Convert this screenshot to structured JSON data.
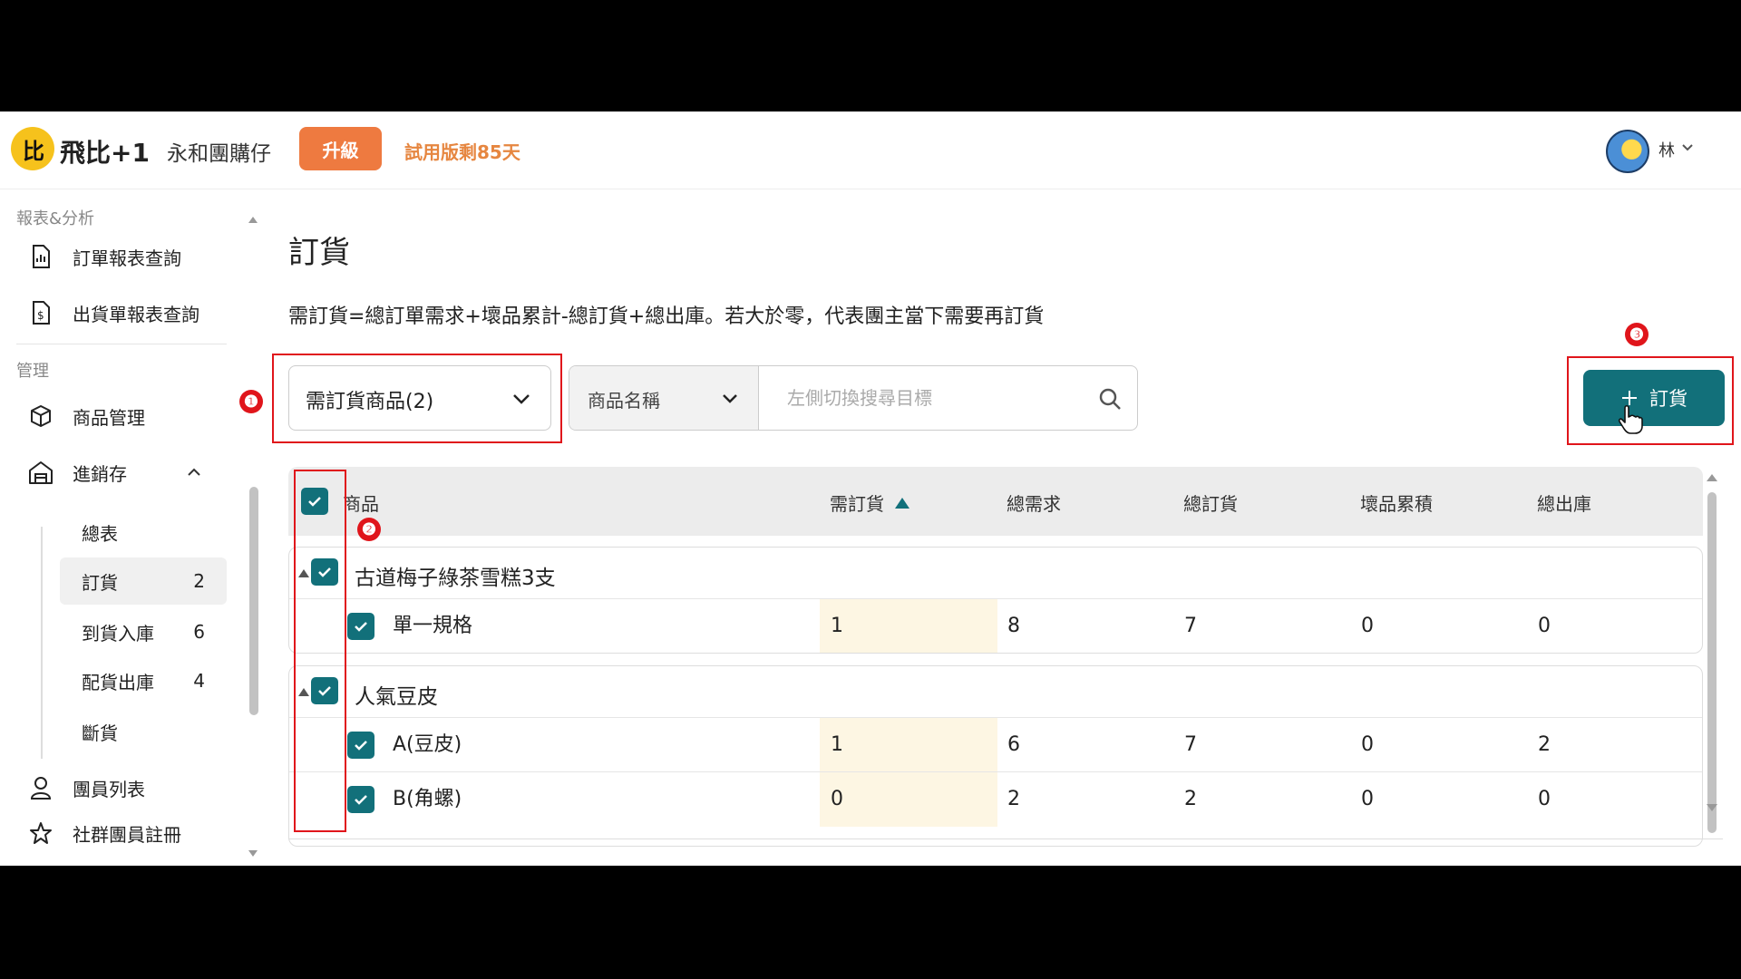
{
  "header": {
    "logo_text": "比",
    "brand": "飛比+1",
    "shop_name": "永和團購仔",
    "upgrade_label": "升級",
    "trial_text": "試用版剩85天",
    "user_name": "林"
  },
  "sidebar": {
    "section_reports": "報表&分析",
    "report_items": [
      {
        "label": "訂單報表查詢",
        "icon": "report-file-icon"
      },
      {
        "label": "出貨單報表查詢",
        "icon": "dollar-file-icon"
      }
    ],
    "section_manage": "管理",
    "manage_items": [
      {
        "label": "商品管理",
        "icon": "box-icon"
      },
      {
        "label": "進銷存",
        "icon": "warehouse-icon"
      }
    ],
    "inventory_sub": [
      {
        "label": "總表",
        "count": ""
      },
      {
        "label": "訂貨",
        "count": "2"
      },
      {
        "label": "到貨入庫",
        "count": "6"
      },
      {
        "label": "配貨出庫",
        "count": "4"
      },
      {
        "label": "斷貨",
        "count": ""
      }
    ],
    "members_label": "團員列表",
    "social_label": "社群團員註冊"
  },
  "main": {
    "title": "訂貨",
    "formula": "需訂貨=總訂單需求+壞品累計-總訂貨+總出庫。若大於零，代表團主當下需要再訂貨",
    "filter_value": "需訂貨商品(2)",
    "search_field": "商品名稱",
    "search_placeholder": "左側切換搜尋目標",
    "search_value": "",
    "order_button": "訂貨"
  },
  "table": {
    "headers": [
      "商品",
      "需訂貨",
      "總需求",
      "總訂貨",
      "壞品累積",
      "總出庫"
    ],
    "groups": [
      {
        "name": "古道梅子綠茶雪糕3支",
        "rows": [
          {
            "spec": "單一規格",
            "need": "1",
            "total_demand": "8",
            "total_ordered": "7",
            "damaged": "0",
            "total_out": "0"
          }
        ]
      },
      {
        "name": "人氣豆皮",
        "rows": [
          {
            "spec": "A(豆皮)",
            "need": "1",
            "total_demand": "6",
            "total_ordered": "7",
            "damaged": "0",
            "total_out": "2"
          },
          {
            "spec": "B(角螺)",
            "need": "0",
            "total_demand": "2",
            "total_ordered": "2",
            "damaged": "0",
            "total_out": "0"
          }
        ]
      }
    ]
  },
  "annotations": [
    "❶",
    "❷",
    "❸"
  ],
  "colors": {
    "teal": "#12707a",
    "orange": "#ee7a40",
    "annotation_red": "#e0151b",
    "need_highlight": "#fdf6e3"
  }
}
